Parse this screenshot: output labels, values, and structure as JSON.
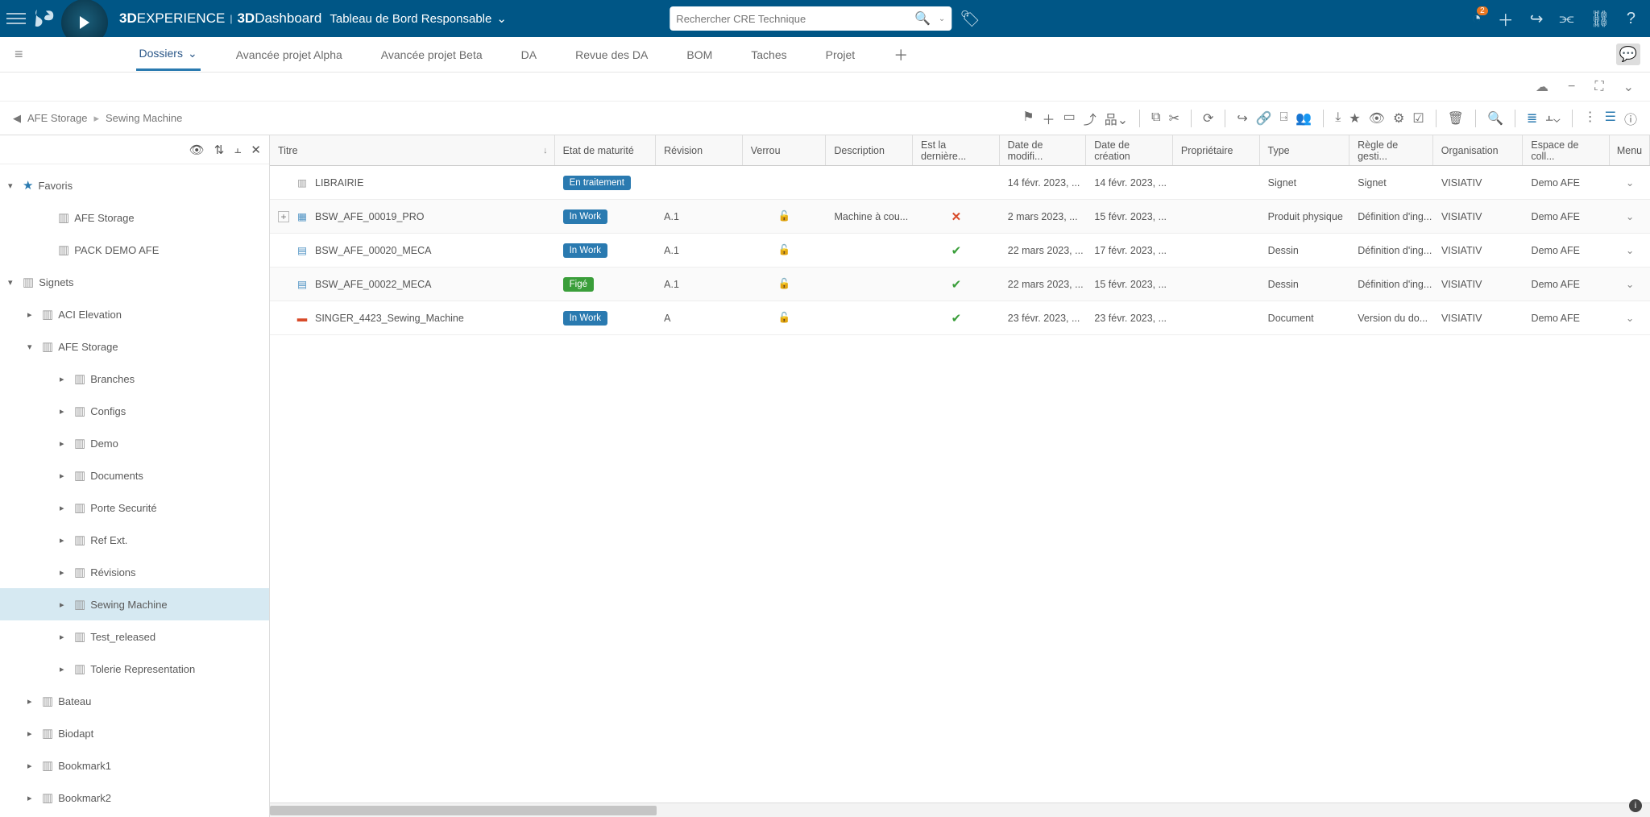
{
  "header": {
    "brand_prefix": "3D",
    "brand_rest": "EXPERIENCE",
    "product": "3DDashboard",
    "dashboard_title": "Tableau de Bord Responsable",
    "search_placeholder": "Rechercher CRE Technique",
    "notification_count": "2"
  },
  "tabs": [
    {
      "label": "Dossiers",
      "active": true,
      "dropdown": true
    },
    {
      "label": "Avancée projet Alpha"
    },
    {
      "label": "Avancée projet Beta"
    },
    {
      "label": "DA"
    },
    {
      "label": "Revue des DA"
    },
    {
      "label": "BOM"
    },
    {
      "label": "Taches"
    },
    {
      "label": "Projet"
    }
  ],
  "breadcrumb": [
    "AFE Storage",
    "Sewing Machine"
  ],
  "sidebar": {
    "favoris_label": "Favoris",
    "favoris": [
      "AFE Storage",
      "PACK DEMO AFE"
    ],
    "signets_label": "Signets",
    "aci_label": "ACI Elevation",
    "afe_label": "AFE Storage",
    "afe_children": [
      "Branches",
      "Configs",
      "Demo",
      "Documents",
      "Porte Securité",
      "Ref Ext.",
      "Révisions",
      "Sewing Machine",
      "Test_released",
      "Tolerie Representation"
    ],
    "signets_rest": [
      "Bateau",
      "Biodapt",
      "Bookmark1",
      "Bookmark2"
    ]
  },
  "columns": {
    "titre": "Titre",
    "maturite": "Etat de maturité",
    "revision": "Révision",
    "verrou": "Verrou",
    "description": "Description",
    "derniere": "Est la dernière...",
    "modif": "Date de modifi...",
    "creation": "Date de création",
    "proprio": "Propriétaire",
    "type": "Type",
    "regle": "Règle de gesti...",
    "organisation": "Organisation",
    "espace": "Espace de coll...",
    "menu": "Menu"
  },
  "rows": [
    {
      "icon": "books",
      "title": "LIBRAIRIE",
      "maturity": "En traitement",
      "mclass": "bm-traite",
      "rev": "",
      "lock": "",
      "desc": "",
      "last": "",
      "modif": "14 févr. 2023, ...",
      "creat": "14 févr. 2023, ...",
      "prop": "",
      "type": "Signet",
      "regle": "Signet",
      "org": "VISIATIV",
      "esp": "Demo AFE",
      "expand": false
    },
    {
      "icon": "cube",
      "title": "BSW_AFE_00019_PRO",
      "maturity": "In Work",
      "mclass": "bm-blue",
      "rev": "A.1",
      "lock": "open",
      "desc": "Machine à cou...",
      "last": "x",
      "modif": "2 mars 2023, ...",
      "creat": "15 févr. 2023, ...",
      "prop": "",
      "type": "Produit physique",
      "regle": "Définition d'ing...",
      "org": "VISIATIV",
      "esp": "Demo AFE",
      "expand": true
    },
    {
      "icon": "draw",
      "title": "BSW_AFE_00020_MECA",
      "maturity": "In Work",
      "mclass": "bm-blue",
      "rev": "A.1",
      "lock": "open",
      "desc": "",
      "last": "v",
      "modif": "22 mars 2023, ...",
      "creat": "17 févr. 2023, ...",
      "prop": "",
      "type": "Dessin",
      "regle": "Définition d'ing...",
      "org": "VISIATIV",
      "esp": "Demo AFE",
      "expand": false
    },
    {
      "icon": "draw",
      "title": "BSW_AFE_00022_MECA",
      "maturity": "Figé",
      "mclass": "bm-green",
      "rev": "A.1",
      "lock": "open",
      "desc": "",
      "last": "v",
      "modif": "22 mars 2023, ...",
      "creat": "15 févr. 2023, ...",
      "prop": "",
      "type": "Dessin",
      "regle": "Définition d'ing...",
      "org": "VISIATIV",
      "esp": "Demo AFE",
      "expand": false
    },
    {
      "icon": "pdf",
      "title": "SINGER_4423_Sewing_Machine",
      "maturity": "In Work",
      "mclass": "bm-blue",
      "rev": "A",
      "lock": "open",
      "desc": "",
      "last": "v",
      "modif": "23 févr. 2023, ...",
      "creat": "23 févr. 2023, ...",
      "prop": "",
      "type": "Document",
      "regle": "Version du do...",
      "org": "VISIATIV",
      "esp": "Demo AFE",
      "expand": false
    }
  ]
}
